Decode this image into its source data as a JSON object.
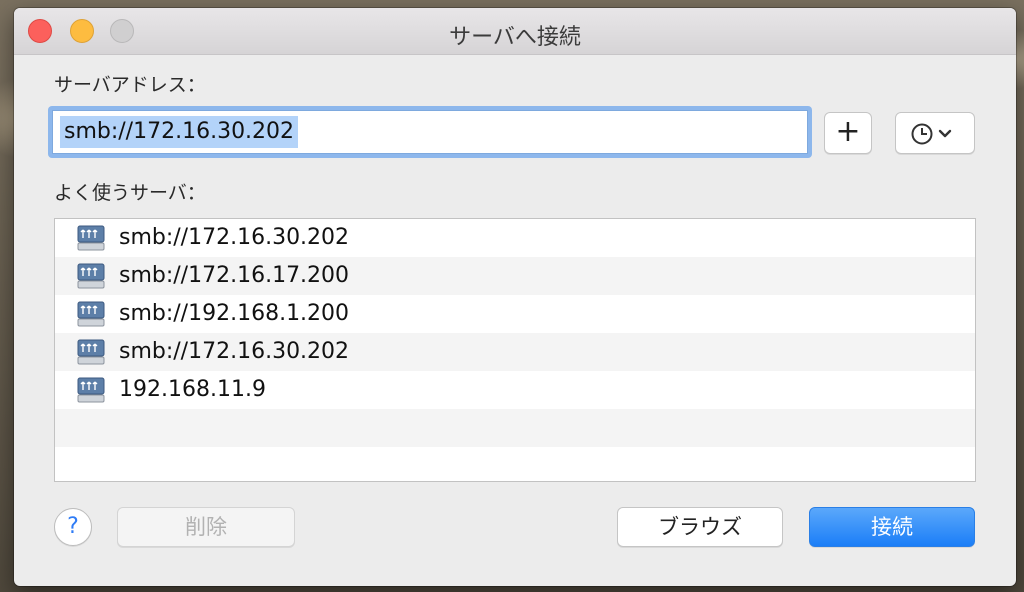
{
  "window": {
    "title": "サーバへ接続"
  },
  "address": {
    "label": "サーバアドレス：",
    "value": "smb://172.16.30.202"
  },
  "favorites": {
    "label": "よく使うサーバ：",
    "items": [
      {
        "text": "smb://172.16.30.202"
      },
      {
        "text": "smb://172.16.17.200"
      },
      {
        "text": "smb://192.168.1.200"
      },
      {
        "text": "smb://172.16.30.202"
      },
      {
        "text": "192.168.11.9"
      }
    ]
  },
  "buttons": {
    "add": "+",
    "help": "?",
    "delete": "削除",
    "browse": "ブラウズ",
    "connect": "接続"
  },
  "colors": {
    "accent": "#1b7ef7",
    "close": "#fc605c",
    "minimize": "#fdbc40",
    "selection": "#b3d3f9"
  }
}
